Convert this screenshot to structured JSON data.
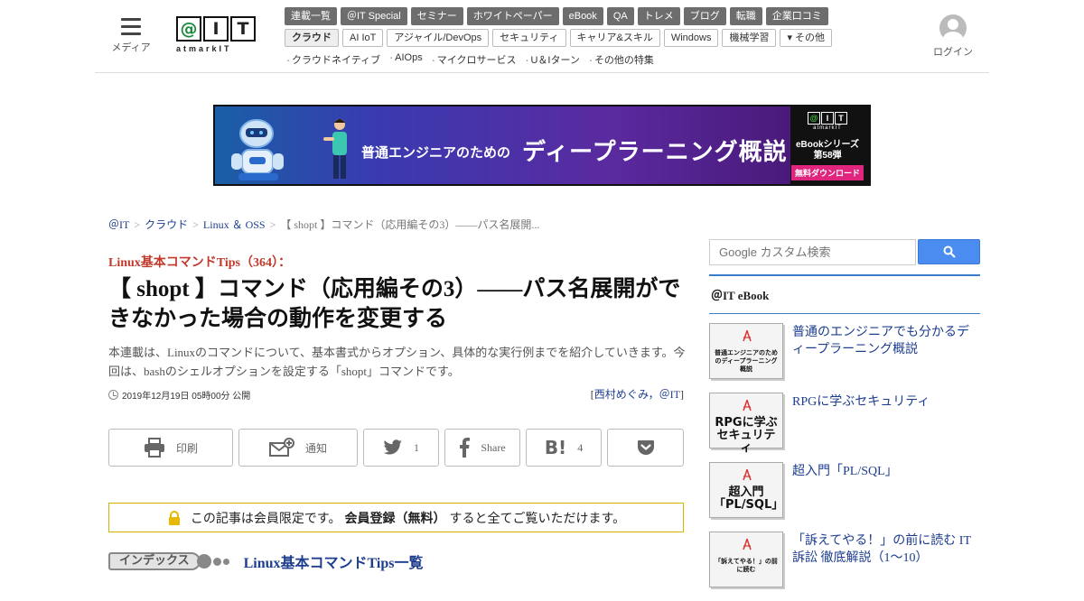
{
  "header": {
    "menu_label": "メディア",
    "logo_letters": [
      "@",
      "I",
      "T"
    ],
    "logo_sub": "atmarkIT",
    "login_label": "ログイン",
    "nav_primary": [
      "連載一覧",
      "＠IT Special",
      "セミナー",
      "ホワイトペーパー",
      "eBook",
      "QA",
      "トレメ",
      "ブログ",
      "転職",
      "企業口コミ"
    ],
    "nav_secondary": [
      "クラウド",
      "AI IoT",
      "アジャイル/DevOps",
      "セキュリティ",
      "キャリア&スキル",
      "Windows",
      "機械学習",
      "▾ その他"
    ],
    "nav_tertiary": [
      "クラウドネイティブ",
      "AIOps",
      "マイクロサービス",
      "U＆Iターン",
      "その他の特集"
    ]
  },
  "banner": {
    "left_text": "普通エンジニアのための",
    "main_text": "ディープラーニング概説",
    "logo_letters": [
      "@",
      "I",
      "T"
    ],
    "logo_sub": "atmarkIT",
    "series_line1": "eBookシリーズ",
    "series_line2": "第58弾",
    "download": "無料ダウンロード"
  },
  "breadcrumb": {
    "items": [
      "＠IT",
      "クラウド",
      "Linux ＆ OSS"
    ],
    "current": "【 shopt 】コマンド（応用編その3）――パス名展開..."
  },
  "article": {
    "series": "Linux基本コマンドTips（364）：",
    "title": "【 shopt 】コマンド（応用編その3）――パス名展開ができなかった場合の動作を変更する",
    "lead": "本連載は、Linuxのコマンドについて、基本書式からオプション、具体的な実行例までを紹介していきます。今回は、bashのシェルオプションを設定する「shopt」コマンドです。",
    "date": "2019年12月19日 05時00分 公開",
    "author_prefix": "[",
    "author_name": "西村めぐみ，＠IT",
    "author_suffix": "]"
  },
  "share": {
    "print": "印刷",
    "notify": "通知",
    "twitter_count": "1",
    "facebook": "Share",
    "hatena_count": "4"
  },
  "members_notice": {
    "pre": "この記事は会員限定です。",
    "bold": "会員登録（無料）",
    "post": "すると全てご覧いただけます。"
  },
  "index": {
    "tag": "インデックス",
    "link": "Linux基本コマンドTips一覧"
  },
  "sidebar": {
    "search_placeholder": "Google カスタム検索",
    "ebook_heading": "＠IT eBook",
    "ebooks": [
      {
        "label": "普通のエンジニアでも分かるディープラーニング概説",
        "cover": "普通エンジニアのためのディープラーニング概説"
      },
      {
        "label": "RPGに学ぶセキュリティ",
        "cover": "RPGに学ぶセキュリティ"
      },
      {
        "label": "超入門「PL/SQL」",
        "cover": "超入門「PL/SQL」"
      },
      {
        "label": "「訴えてやる！」の前に読む IT訴訟 徹底解説（1～10）",
        "cover": "「訴えてやる！」の前に読む"
      }
    ]
  },
  "colors": {
    "nav_dark": "#6d6d6d",
    "series_red": "#c0392b",
    "link_blue": "#1d3d8f",
    "search_blue": "#4a8cf0",
    "notice_border": "#d4b400",
    "lock_yellow": "#e8b800"
  },
  "icons": [
    "hamburger-icon",
    "user-avatar-icon",
    "search-icon",
    "clock-icon",
    "print-icon",
    "mail-plus-icon",
    "twitter-icon",
    "facebook-icon",
    "hatena-bookmark-icon",
    "pocket-icon",
    "lock-icon",
    "pdf-icon"
  ]
}
